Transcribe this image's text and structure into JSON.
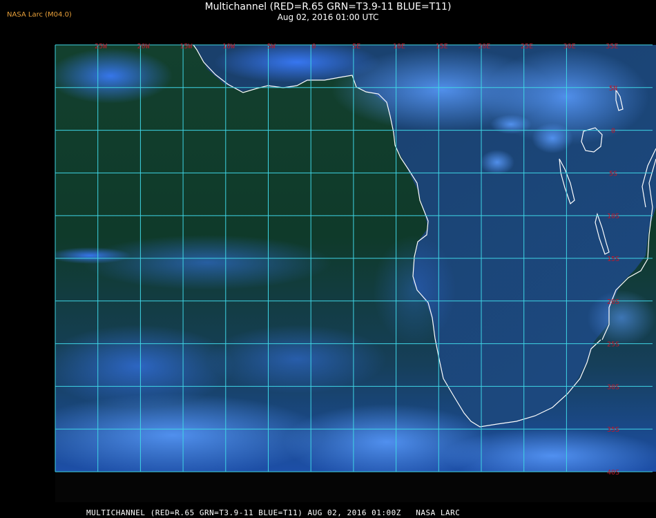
{
  "header": {
    "title": "Multichannel (RED=R.65 GRN=T3.9-11 BLUE=T11)",
    "subtitle": "Aug 02, 2016 01:00 UTC",
    "source_tag": "NASA Larc (M04.0)"
  },
  "footer": {
    "caption": "MULTICHANNEL (RED=R.65 GRN=T3.9-11 BLUE=T11) AUG 02, 2016 01:00Z   NASA LARC"
  },
  "map": {
    "longitude_labels": [
      "25W",
      "20W",
      "15W",
      "10W",
      "5W",
      "0",
      "5E",
      "10E",
      "15E",
      "20E",
      "25E",
      "30E",
      "35E"
    ],
    "latitude_labels": [
      "5N",
      "0",
      "5S",
      "10S",
      "15S",
      "20S",
      "25S",
      "30S",
      "35S",
      "40S"
    ],
    "colors": {
      "grid": "#3fd6e6",
      "label": "#c0182a",
      "coast": "#ffffff",
      "ocean": "#0e3a2a",
      "land": "#1b4470",
      "cloud": "#2a66ff"
    }
  }
}
